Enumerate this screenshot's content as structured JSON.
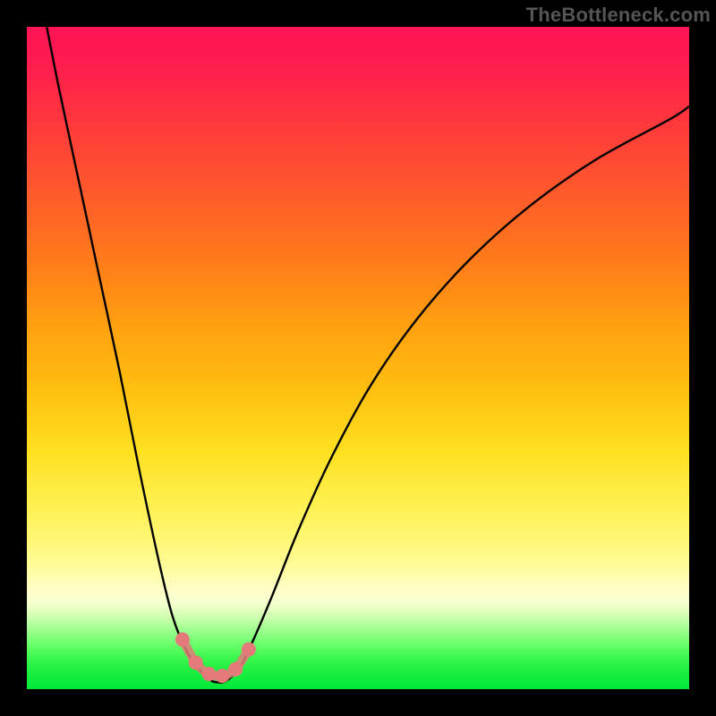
{
  "watermark": "TheBottleneck.com",
  "chart_data": {
    "type": "line",
    "title": "",
    "xlabel": "",
    "ylabel": "",
    "xlim": [
      0,
      100
    ],
    "ylim": [
      0,
      100
    ],
    "grid": false,
    "legend": null,
    "series": [
      {
        "name": "bottleneck-curve-left",
        "color": "#000000",
        "x": [
          3,
          5,
          8,
          11,
          14,
          17,
          20,
          22,
          24,
          26,
          27,
          28,
          29
        ],
        "values": [
          100,
          90,
          76,
          62,
          48,
          33,
          19,
          11,
          6,
          3,
          2,
          1.2,
          1
        ]
      },
      {
        "name": "bottleneck-curve-right",
        "color": "#000000",
        "x": [
          29,
          30,
          32,
          34,
          37,
          41,
          46,
          52,
          59,
          67,
          76,
          86,
          97,
          100
        ],
        "values": [
          1,
          1.2,
          3,
          7,
          14,
          24,
          35,
          46,
          56,
          65,
          73,
          80,
          86,
          88
        ]
      },
      {
        "name": "minimum-band-markers",
        "color": "#e47a7a",
        "x": [
          23.5,
          25.5,
          27.5,
          29.5,
          31.5,
          33.5
        ],
        "values": [
          7.5,
          4.0,
          2.3,
          2.0,
          3.0,
          6.0
        ]
      }
    ],
    "background_gradient": {
      "top": "#ff1455",
      "mid_upper": "#ff8a15",
      "mid": "#ffe020",
      "mid_lower": "#fffda0",
      "bottom": "#00e838"
    }
  }
}
